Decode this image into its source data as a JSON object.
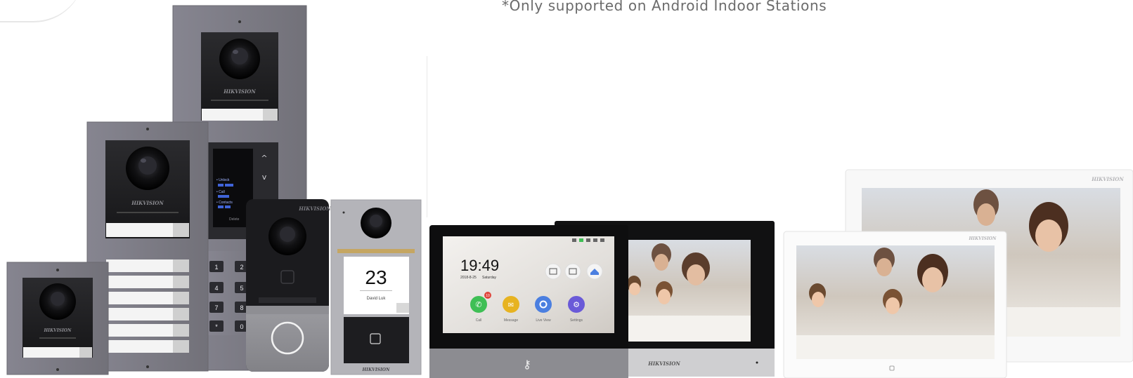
{
  "caption": {
    "text": "*Only supported on Android Indoor Stations"
  },
  "brand": {
    "logo_text": "HIKVISION"
  },
  "keypad_display": {
    "lines": [
      "• Unlock",
      "• Call",
      "• Contacts"
    ],
    "footer": "Delete"
  },
  "door_station": {
    "room_number": "23",
    "resident_name": "David Luk"
  },
  "indoor_station_home": {
    "time": "19:49",
    "date": "2018-8-25",
    "weekday": "Saturday",
    "apps": [
      {
        "label": "Call",
        "icon": "phone-icon",
        "color": "#3fbf55",
        "badge": "10"
      },
      {
        "label": "Message",
        "icon": "envelope-icon",
        "color": "#e7b321"
      },
      {
        "label": "Live View",
        "icon": "eye-icon",
        "color": "#4b7fe0"
      },
      {
        "label": "Settings",
        "icon": "gear-icon",
        "color": "#6a5ad8"
      }
    ]
  },
  "colors": {
    "panel_gray": "#7c7b84",
    "panel_dark": "#1d1d1f",
    "monitor_black": "#111112",
    "monitor_white": "#f7f7f7"
  }
}
